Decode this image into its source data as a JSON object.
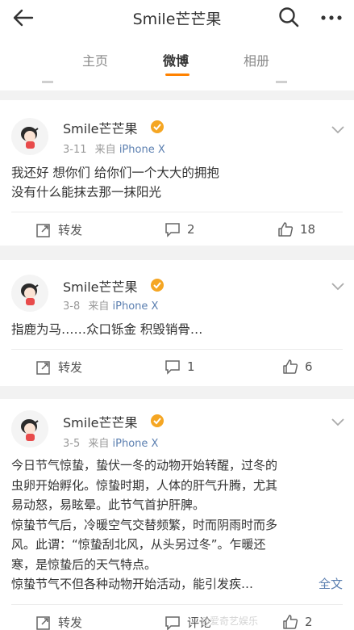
{
  "header": {
    "title": "Smile芒芒果"
  },
  "tabs": [
    {
      "label": "主页"
    },
    {
      "label": "微博"
    },
    {
      "label": "相册"
    }
  ],
  "posts": [
    {
      "user": "Smile芒芒果",
      "date": "3-11",
      "source_prefix": "来自",
      "source": "iPhone X",
      "lines": [
        "我还好 想你们 给你们一个大大的拥抱",
        "没有什么能抹去那一抹阳光"
      ],
      "repost_label": "转发",
      "comments": "2",
      "likes": "18"
    },
    {
      "user": "Smile芒芒果",
      "date": "3-8",
      "source_prefix": "来自",
      "source": "iPhone X",
      "lines": [
        "指鹿为马……众口铄金 积毁销骨…"
      ],
      "repost_label": "转发",
      "comments": "1",
      "likes": "6"
    },
    {
      "user": "Smile芒芒果",
      "date": "3-5",
      "source_prefix": "来自",
      "source": "iPhone X",
      "lines": [
        "今日节气惊蛰，蛰伏一冬的动物开始转醒，过冬的",
        "虫卵开始孵化。惊蛰时期，人体的肝气升腾，尤其",
        "易动怒，易眩晕。此节气首护肝脾。",
        " 惊蛰节气后，冷暖空气交替频繁，时而阴雨时而多",
        "风。此谓：“惊蛰刮北风，从头另过冬”。乍暖还",
        "寒，是惊蛰后的天气特点。",
        " 惊蛰节气不但各种动物开始活动，能引发疾…"
      ],
      "full_text_link": "全文",
      "repost_label": "转发",
      "comments_label": "评论",
      "likes": "2"
    }
  ],
  "watermark": "@爱奇艺娱乐",
  "colors": {
    "accent": "#ff8200",
    "link": "#5b7fb0",
    "badge": "#f5a623"
  },
  "icons": [
    "back-arrow-icon",
    "search-icon",
    "more-dots-icon",
    "verified-badge-icon",
    "chevron-down-icon",
    "repost-icon",
    "comment-icon",
    "like-icon"
  ]
}
